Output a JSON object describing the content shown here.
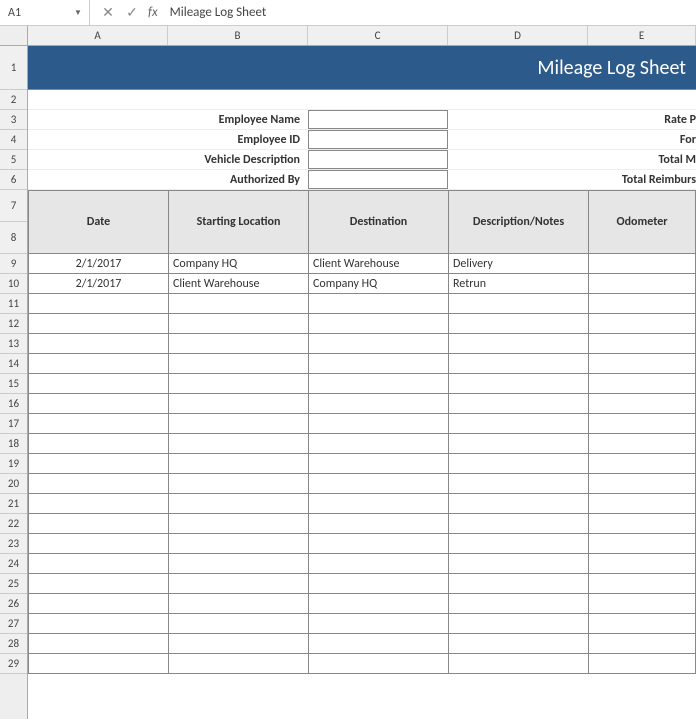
{
  "formulaBar": {
    "cellRef": "A1",
    "fxLabel": "fx",
    "formula": "Mileage Log Sheet"
  },
  "columns": [
    "A",
    "B",
    "C",
    "D",
    "E"
  ],
  "rows": [
    "1",
    "2",
    "3",
    "4",
    "5",
    "6",
    "7",
    "8",
    "9",
    "10",
    "11",
    "12",
    "13",
    "14",
    "15",
    "16",
    "17",
    "18",
    "19",
    "20",
    "21",
    "22",
    "23",
    "24",
    "25",
    "26",
    "27",
    "28",
    "29"
  ],
  "title": "Mileage Log Sheet",
  "infoLabels": {
    "employeeName": "Employee Name",
    "employeeId": "Employee ID",
    "vehicleDescription": "Vehicle Description",
    "authorizedBy": "Authorized By",
    "ratePer": "Rate P",
    "for": "For",
    "totalM": "Total M",
    "totalReimburs": "Total Reimburs"
  },
  "tableHeaders": {
    "date": "Date",
    "startingLocation": "Starting Location",
    "destination": "Destination",
    "descriptionNotes": "Description/Notes",
    "odometer": "Odometer"
  },
  "tableRows": [
    {
      "date": "2/1/2017",
      "start": "Company HQ",
      "dest": "Client Warehouse",
      "desc": "Delivery",
      "odo": ""
    },
    {
      "date": "2/1/2017",
      "start": "Client Warehouse",
      "dest": "Company HQ",
      "desc": "Retrun",
      "odo": ""
    },
    {
      "date": "",
      "start": "",
      "dest": "",
      "desc": "",
      "odo": ""
    },
    {
      "date": "",
      "start": "",
      "dest": "",
      "desc": "",
      "odo": ""
    },
    {
      "date": "",
      "start": "",
      "dest": "",
      "desc": "",
      "odo": ""
    },
    {
      "date": "",
      "start": "",
      "dest": "",
      "desc": "",
      "odo": ""
    },
    {
      "date": "",
      "start": "",
      "dest": "",
      "desc": "",
      "odo": ""
    },
    {
      "date": "",
      "start": "",
      "dest": "",
      "desc": "",
      "odo": ""
    },
    {
      "date": "",
      "start": "",
      "dest": "",
      "desc": "",
      "odo": ""
    },
    {
      "date": "",
      "start": "",
      "dest": "",
      "desc": "",
      "odo": ""
    },
    {
      "date": "",
      "start": "",
      "dest": "",
      "desc": "",
      "odo": ""
    },
    {
      "date": "",
      "start": "",
      "dest": "",
      "desc": "",
      "odo": ""
    },
    {
      "date": "",
      "start": "",
      "dest": "",
      "desc": "",
      "odo": ""
    },
    {
      "date": "",
      "start": "",
      "dest": "",
      "desc": "",
      "odo": ""
    },
    {
      "date": "",
      "start": "",
      "dest": "",
      "desc": "",
      "odo": ""
    },
    {
      "date": "",
      "start": "",
      "dest": "",
      "desc": "",
      "odo": ""
    },
    {
      "date": "",
      "start": "",
      "dest": "",
      "desc": "",
      "odo": ""
    },
    {
      "date": "",
      "start": "",
      "dest": "",
      "desc": "",
      "odo": ""
    },
    {
      "date": "",
      "start": "",
      "dest": "",
      "desc": "",
      "odo": ""
    },
    {
      "date": "",
      "start": "",
      "dest": "",
      "desc": "",
      "odo": ""
    },
    {
      "date": "",
      "start": "",
      "dest": "",
      "desc": "",
      "odo": ""
    }
  ]
}
